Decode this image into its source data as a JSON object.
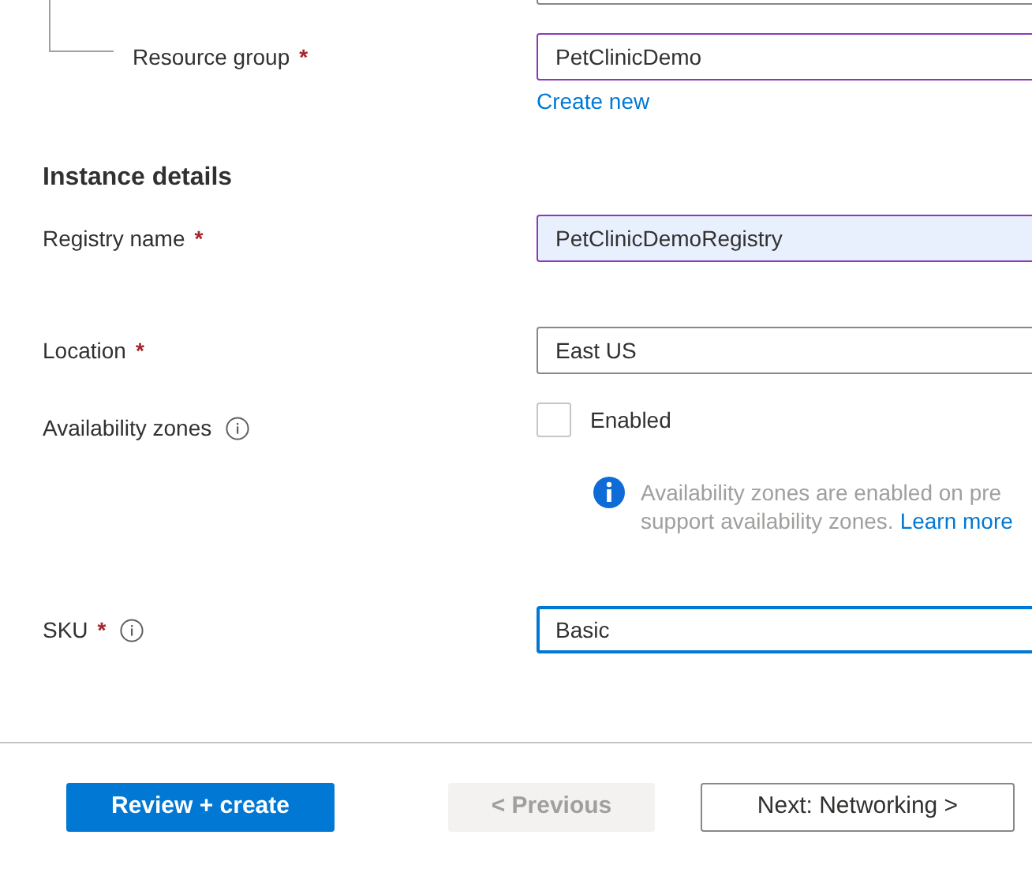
{
  "resource_group": {
    "label": "Resource group",
    "required_mark": "*",
    "value": "PetClinicDemo",
    "validated": true,
    "autofilled": false,
    "focused": false,
    "link": "Create new"
  },
  "instance_details": {
    "heading": "Instance details",
    "fields": [
      {
        "kind": "text",
        "label": "Registry name",
        "required_mark": "*",
        "value": "PetClinicDemoRegistry",
        "validated": true,
        "autofilled": true,
        "focused": false
      },
      {
        "kind": "select",
        "label": "Location",
        "required_mark": "*",
        "value": "East US",
        "validated": false,
        "autofilled": false,
        "focused": false
      },
      {
        "kind": "checkbox",
        "label": "Availability zones",
        "info_icon": true,
        "option": "Enabled",
        "checked": false,
        "note": {
          "text": "Availability zones are enabled on pre",
          "text_2": "support availability zones.",
          "link": "Learn more"
        }
      },
      {
        "kind": "select",
        "label": "SKU",
        "required_mark": "*",
        "info_icon": true,
        "value": "Basic",
        "autofilled": false,
        "focused": true
      }
    ]
  },
  "buttons": [
    {
      "label": "Review + create",
      "kind": "primary",
      "disabled": false
    },
    {
      "label": "< Previous",
      "kind": "secondary",
      "disabled": true
    },
    {
      "label": "Next: Networking >",
      "kind": "secondary",
      "disabled": false
    }
  ]
}
